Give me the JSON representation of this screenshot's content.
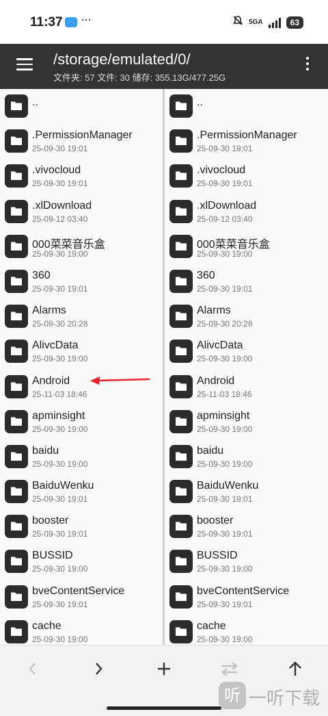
{
  "status_bar": {
    "time": "11:37",
    "notification_dots": "···",
    "network": "5GA",
    "battery": "63"
  },
  "toolbar": {
    "path": "/storage/emulated/0/",
    "stats": "文件夹: 57  文件: 30  储存: 355.13G/477.25G"
  },
  "files": [
    {
      "name": "..",
      "date": ""
    },
    {
      "name": ".PermissionManager",
      "date": "25-09-30 19:01"
    },
    {
      "name": ".vivocloud",
      "date": "25-09-30 19:01"
    },
    {
      "name": ".xlDownload",
      "date": "25-09-12 03:40"
    },
    {
      "name": "000菜菜音乐盒",
      "date": "25-09-30 19:00"
    },
    {
      "name": "360",
      "date": "25-09-30 19:01"
    },
    {
      "name": "Alarms",
      "date": "25-09-30 20:28"
    },
    {
      "name": "AlivcData",
      "date": "25-09-30 19:00"
    },
    {
      "name": "Android",
      "date": "25-11-03 18:46"
    },
    {
      "name": "apminsight",
      "date": "25-09-30 19:00"
    },
    {
      "name": "baidu",
      "date": "25-09-30 19:00"
    },
    {
      "name": "BaiduWenku",
      "date": "25-09-30 19:01"
    },
    {
      "name": "booster",
      "date": "25-09-30 19:01"
    },
    {
      "name": "BUSSID",
      "date": "25-09-30 19:00"
    },
    {
      "name": "bveContentService",
      "date": "25-09-30 19:01"
    },
    {
      "name": "cache",
      "date": "25-09-30 19:00"
    }
  ],
  "colors": {
    "toolbar_bg": "#333333",
    "folder_icon": "#2b2b2b",
    "annotation_arrow": "#e8202a"
  },
  "bottom_bar": {
    "icons": [
      "back-arrow-icon",
      "forward-arrow-icon",
      "add-icon",
      "swap-icon",
      "up-arrow-icon"
    ]
  },
  "watermark": {
    "logo_char": "听",
    "text": "一听下载"
  }
}
